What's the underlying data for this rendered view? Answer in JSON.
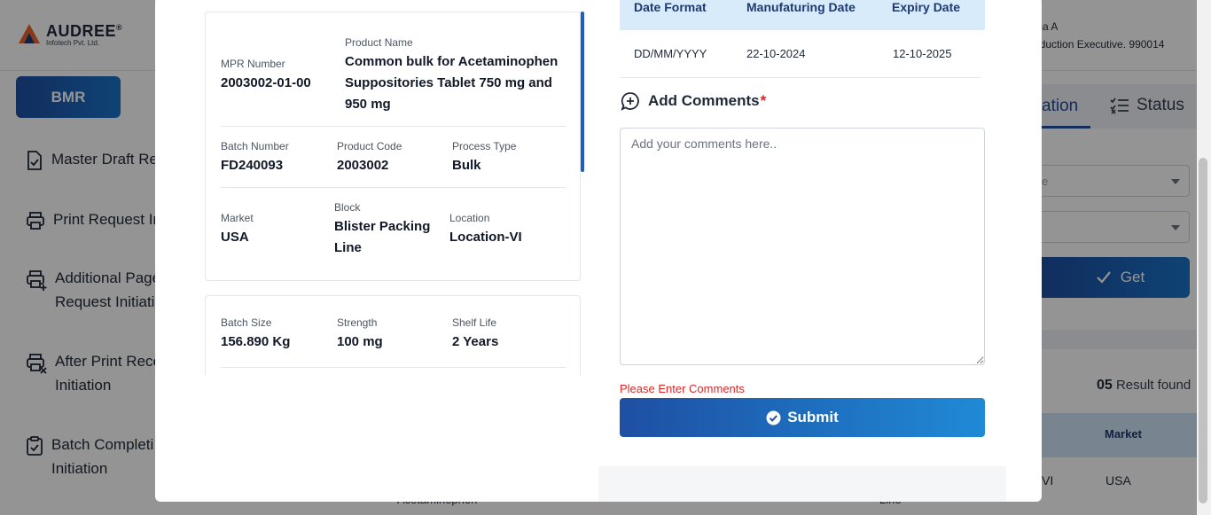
{
  "app": {
    "brand": "AUDREE",
    "brand_mark": "®",
    "brand_sub": "Infotech Pvt. Ltd.",
    "user_name_partial": "ma A",
    "user_role_partial": "oduction Executive. 990014"
  },
  "sidebar": {
    "bmr_label": "BMR",
    "items": [
      {
        "line1": "Master Draft Rev",
        "line2": ""
      },
      {
        "line1": "Print Request In",
        "line2": ""
      },
      {
        "line1": "Additional Page",
        "line2": "Request Initiatio"
      },
      {
        "line1": "After Print Recei",
        "line2": "Initiation"
      },
      {
        "line1": "Batch Completi",
        "line2": "Initiation"
      }
    ]
  },
  "background_panel": {
    "active_tab_partial": "ation",
    "status_tab": "Status",
    "select1_partial": "e",
    "get_label": "Get",
    "result_count": "05",
    "result_text": "Result found",
    "th_market": "Market",
    "row_col_partial": "VI",
    "row_market": "USA",
    "row_text_left": "Acetaminophen",
    "row_text_mid": "Line"
  },
  "modal": {
    "product_card": {
      "mpr_label": "MPR Number",
      "mpr_value": "2003002-01-00",
      "product_name_label": "Product Name",
      "product_name_value": "Common bulk for Acetaminophen Suppositories Tablet 750 mg and 950 mg",
      "batch_number_label": "Batch Number",
      "batch_number_value": "FD240093",
      "product_code_label": "Product Code",
      "product_code_value": "2003002",
      "process_type_label": "Process Type",
      "process_type_value": "Bulk",
      "market_label": "Market",
      "market_value": "USA",
      "block_label": "Block",
      "block_value": "Blister Packing Line",
      "location_label": "Location",
      "location_value": "Location-VI"
    },
    "batch_card": {
      "batch_size_label": "Batch Size",
      "batch_size_value": "156.890 Kg",
      "strength_label": "Strength",
      "strength_value": "100 mg",
      "shelf_life_label": "Shelf Life",
      "shelf_life_value": "2 Years"
    },
    "dates": {
      "headers": [
        "Date Format",
        "Manufaturing Date",
        "Expiry Date"
      ],
      "values": [
        "DD/MM/YYYY",
        "22-10-2024",
        "12-10-2025"
      ]
    },
    "comments": {
      "title": "Add Comments",
      "required_mark": "*",
      "placeholder": "Add your comments here..",
      "value": "",
      "error": "Please Enter Comments"
    },
    "submit_label": "Submit"
  },
  "colors": {
    "primary": "#1e4fa3",
    "primary_light": "#1f8ad6",
    "error": "#dc2626",
    "table_header_bg": "#d8ebfb"
  }
}
